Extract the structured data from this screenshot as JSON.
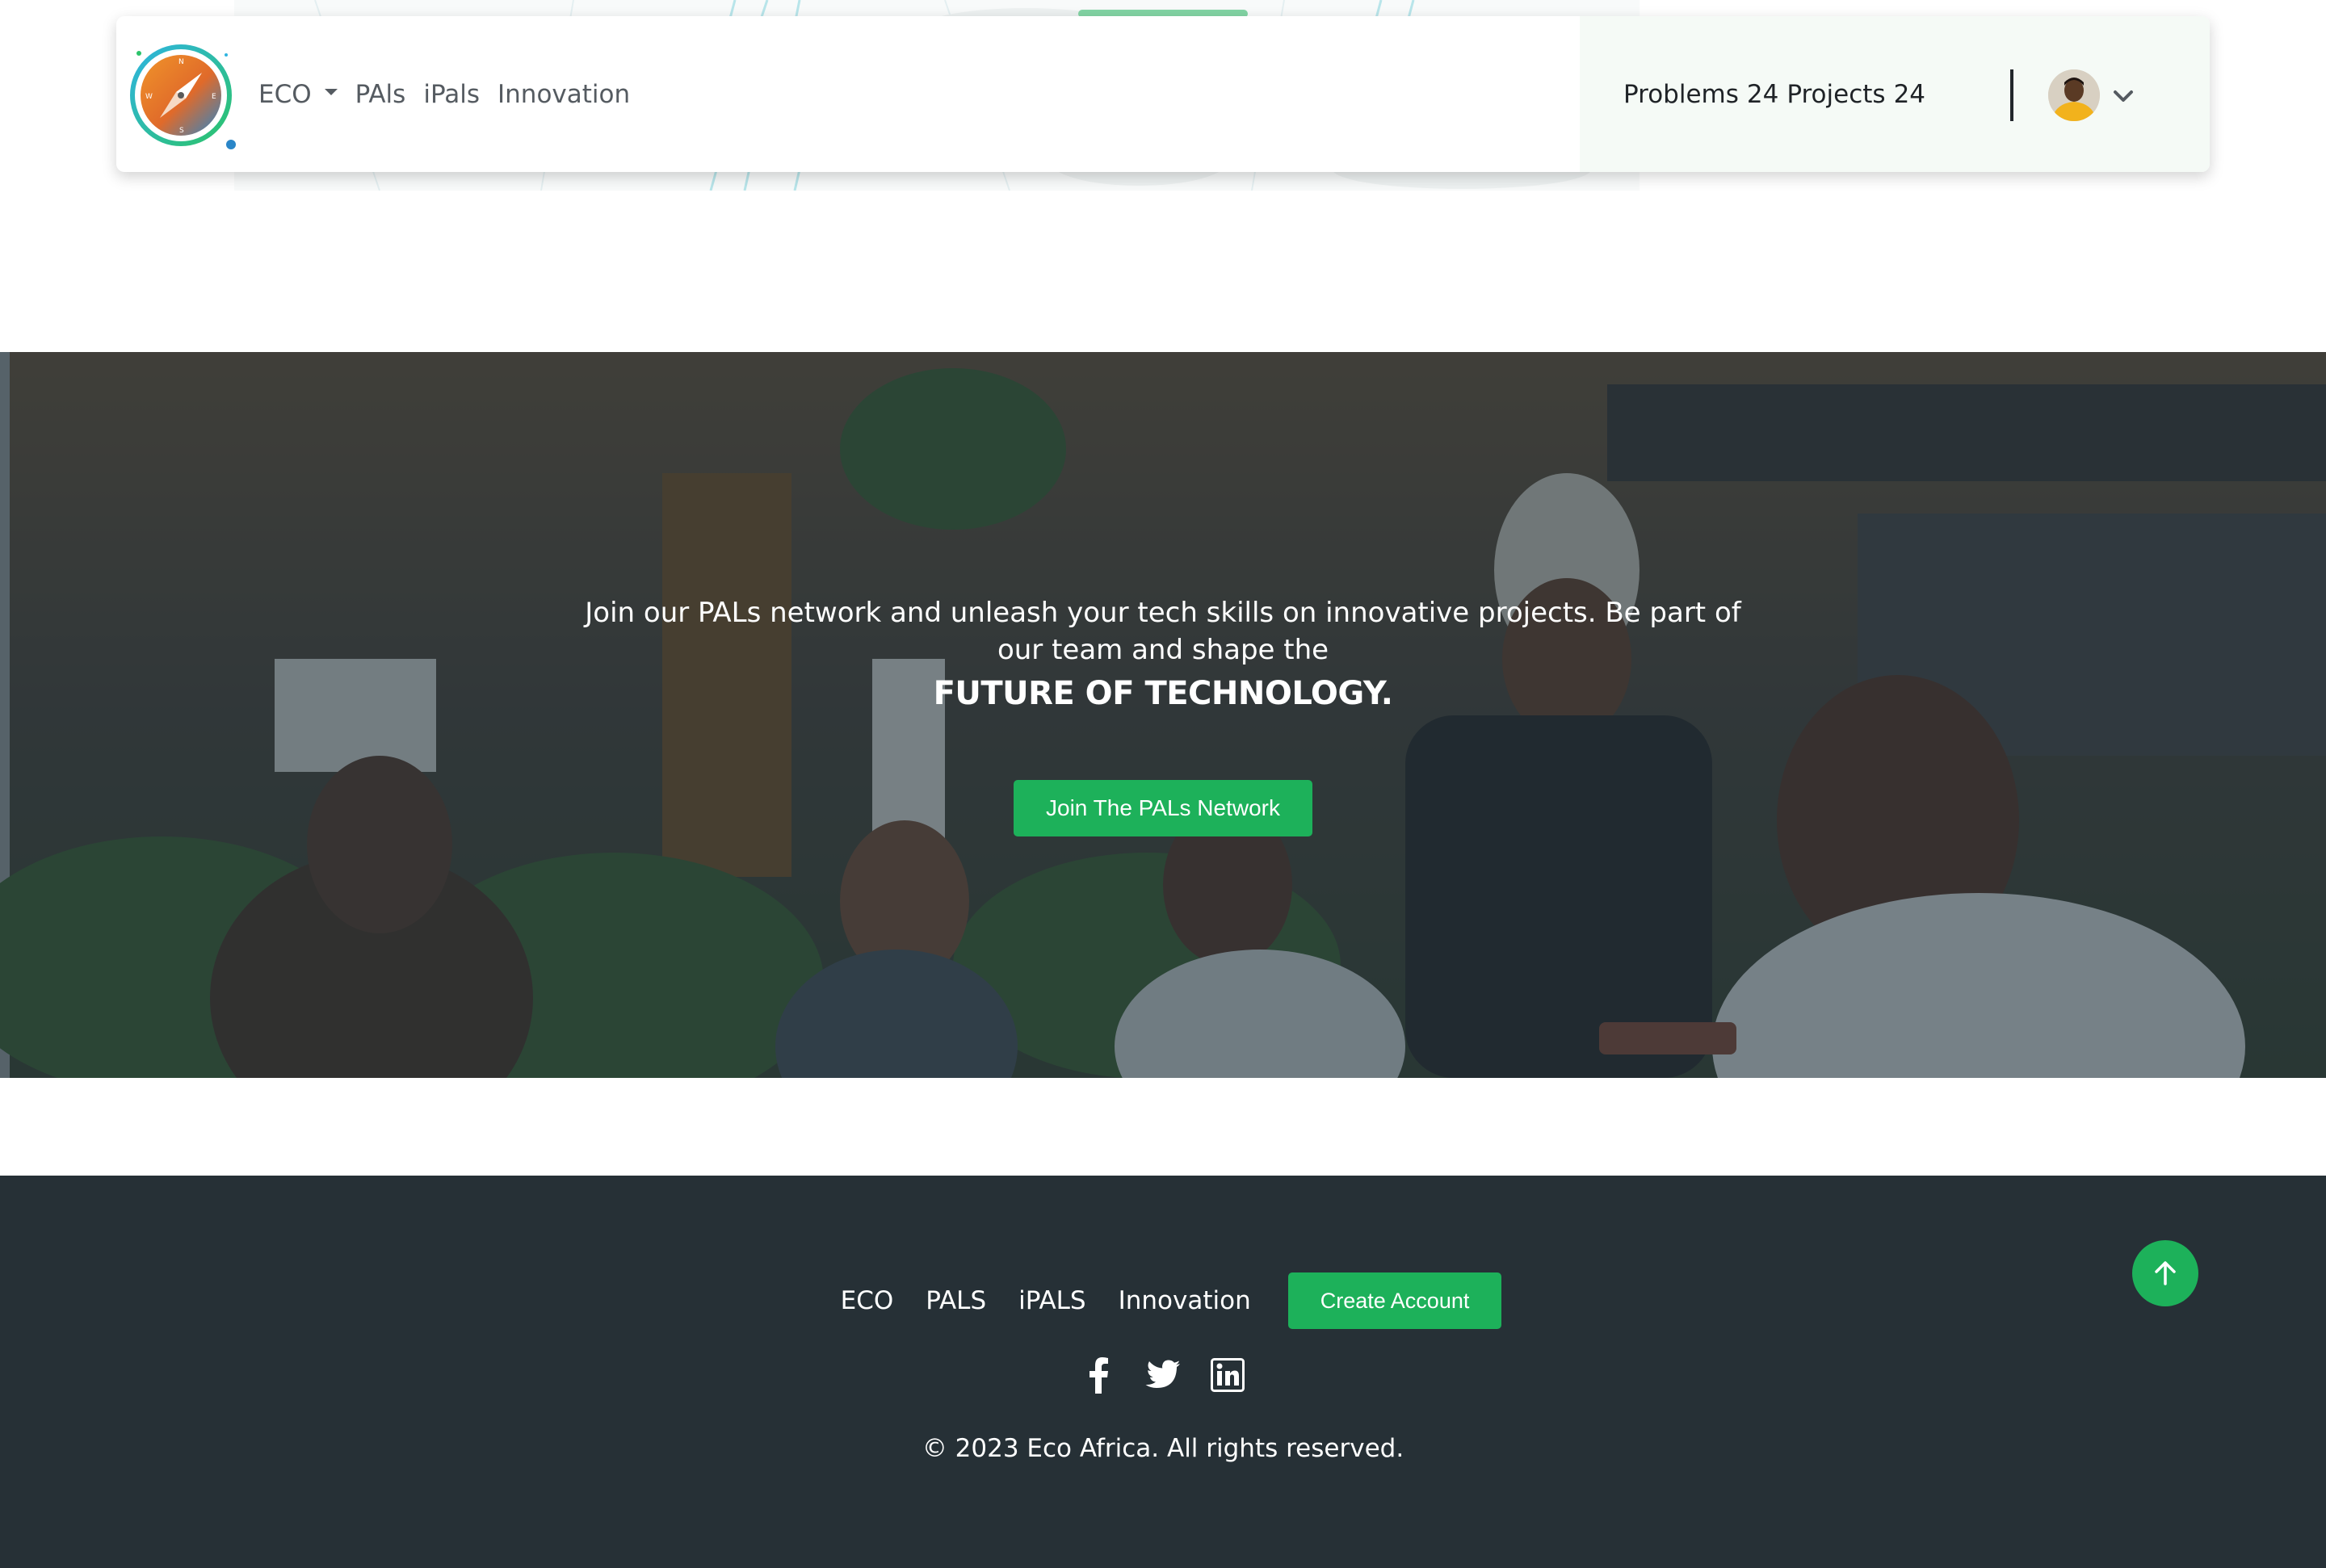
{
  "navbar": {
    "brand_logo": "compass-logo",
    "links": [
      {
        "label": "ECO",
        "has_dropdown": true
      },
      {
        "label": "PAls",
        "has_dropdown": false
      },
      {
        "label": "iPals",
        "has_dropdown": false
      },
      {
        "label": "Innovation",
        "has_dropdown": false
      }
    ],
    "counts": {
      "problems_label": "Problems",
      "problems_value": "24",
      "projects_label": "Projects",
      "projects_value": "24"
    },
    "user_menu_icon": "chevron-down-icon"
  },
  "hero": {
    "text": "Join our PALs network and unleash your tech skills on innovative projects. Be part of our team and shape the",
    "strong": "FUTURE OF TECHNOLOGY.",
    "button_label": "Join The PALs Network"
  },
  "footer": {
    "links": [
      "ECO",
      "PALS",
      "iPALS",
      "Innovation"
    ],
    "button_label": "Create Account",
    "socials": [
      "facebook-icon",
      "twitter-icon",
      "linkedin-icon"
    ],
    "copyright": "© 2023 Eco Africa. All rights reserved.",
    "back_to_top_icon": "arrow-up-icon"
  },
  "colors": {
    "accent_green": "#1db15a",
    "footer_bg": "#263036",
    "nav_right_bg": "#f5faf6",
    "text_dark": "#1f2327",
    "text_muted": "#555b61"
  }
}
